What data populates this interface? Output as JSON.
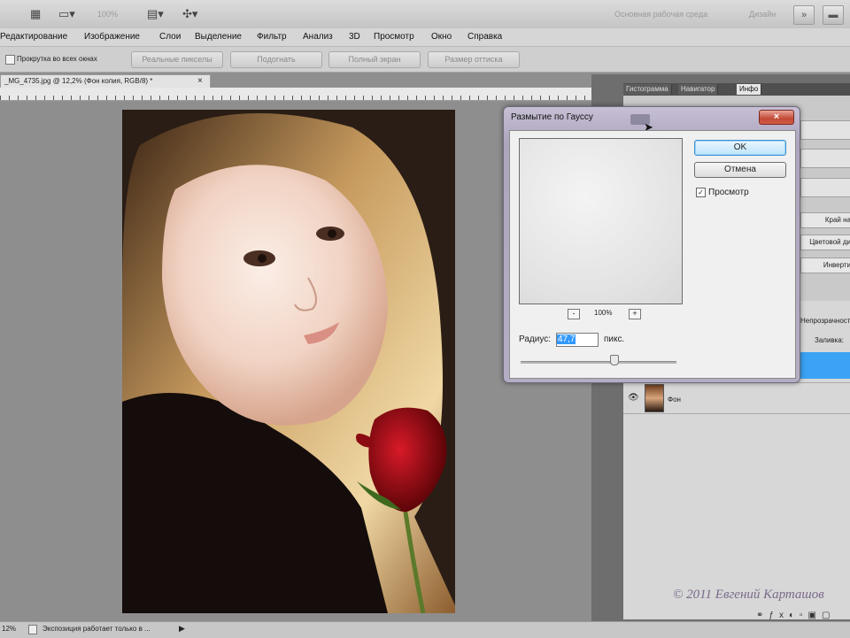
{
  "appbar": {
    "zoom": "100%",
    "workspace_label": "Основная рабочая среда",
    "design_label": "Дизайн",
    "icons": [
      "screen-mode-icon",
      "zoom-level-icon",
      "arrange-icon",
      "extras-icon",
      "workspace-expand-icon",
      "minimize-icon"
    ]
  },
  "menu": {
    "items": [
      "Редактирование",
      "Изображение",
      "Слои",
      "Выделение",
      "Фильтр",
      "Анализ",
      "3D",
      "Просмотр",
      "Окно",
      "Справка"
    ]
  },
  "options": {
    "scroll_all_label": "Прокрутка во всех окнах",
    "buttons": [
      "Реальные пикселы",
      "Подогнать",
      "Полный экран",
      "Размер оттиска"
    ]
  },
  "document": {
    "tab_title": "_MG_4735.jpg @ 12,2% (Фон копия, RGB/8) *",
    "close": "×"
  },
  "panels": {
    "tabs": [
      "Гистограмма",
      "Навигатор",
      "Инфо"
    ],
    "side_labels": [
      "Край на",
      "Цветовой ди",
      "Инверти"
    ],
    "opacity_label": "Непрозрачность:",
    "fill_label": "Заливка:",
    "layer_name": "Фон"
  },
  "status": {
    "zoom": "12%",
    "message": "Экспозиция работает только в ..."
  },
  "dialog": {
    "title": "Размытие по Гауссу",
    "close": "×",
    "ok": "OK",
    "cancel": "Отмена",
    "preview_label": "Просмотр",
    "preview_checked": true,
    "zoom_minus": "-",
    "zoom_value": "100%",
    "zoom_plus": "+",
    "radius_label": "Радиус:",
    "radius_value": "47,7",
    "radius_unit": "пикс.",
    "radius_level": 0.6
  },
  "watermark": "© 2011 Евгений Карташов"
}
